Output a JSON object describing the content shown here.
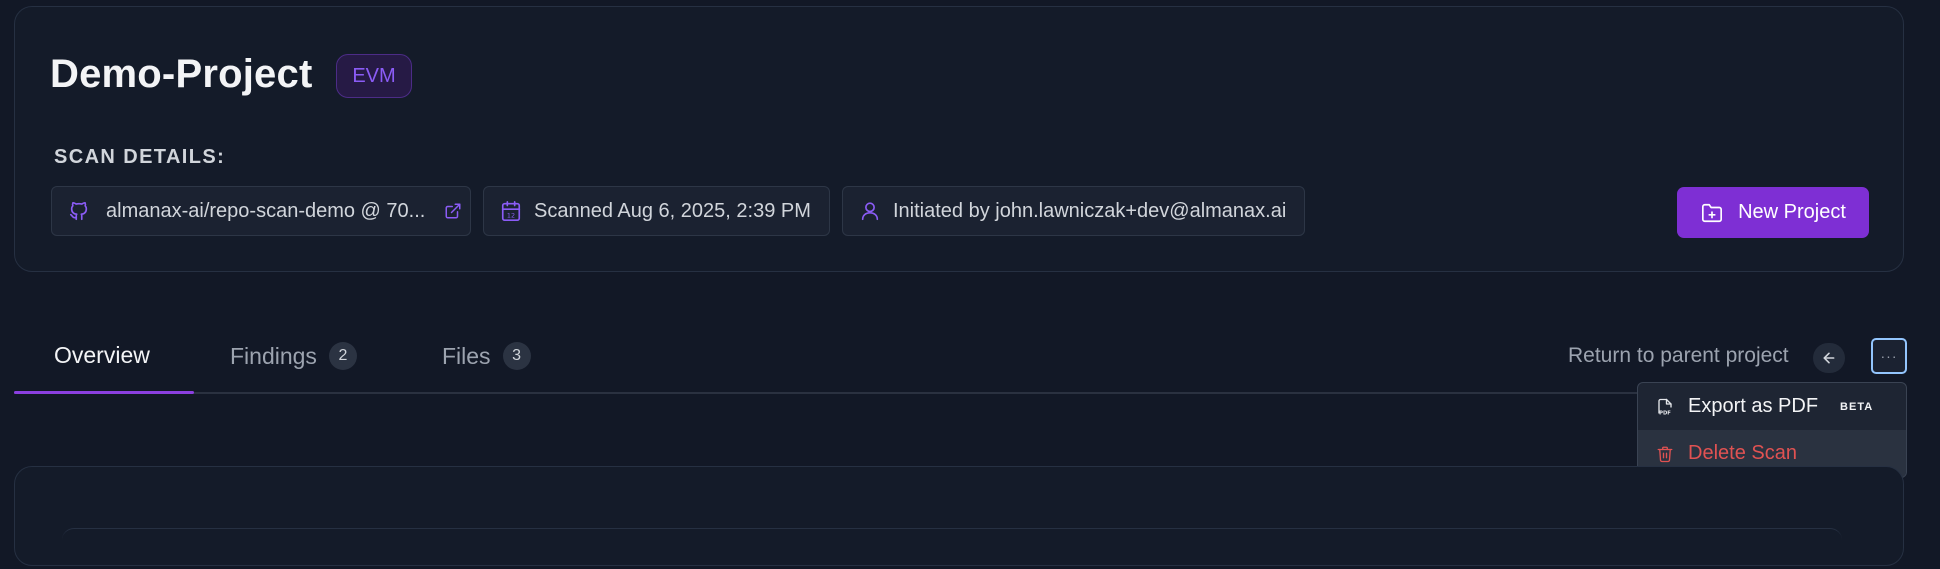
{
  "project": {
    "title": "Demo-Project",
    "chain_badge": "EVM"
  },
  "scan_details": {
    "label": "SCAN DETAILS:",
    "repo": "almanax-ai/repo-scan-demo @ 70...",
    "scanned": "Scanned Aug 6, 2025, 2:39 PM",
    "initiated_by": "Initiated by john.lawniczak+dev@almanax.ai"
  },
  "actions": {
    "new_project_label": "New Project",
    "return_label": "Return to parent project",
    "more_label": "···"
  },
  "tabs": [
    {
      "label": "Overview",
      "count": null,
      "active": true
    },
    {
      "label": "Findings",
      "count": "2",
      "active": false
    },
    {
      "label": "Files",
      "count": "3",
      "active": false
    }
  ],
  "menu": {
    "export_label": "Export as PDF",
    "beta_label": "BETA",
    "delete_label": "Delete Scan"
  },
  "colors": {
    "accent": "#7e2fd4",
    "danger": "#e05252",
    "background": "#121826"
  },
  "icons": {
    "repo": "github-icon",
    "external": "external-link-icon",
    "date": "calendar-icon",
    "user": "user-icon",
    "new_project": "folder-plus-icon",
    "back": "arrow-left-icon",
    "pdf": "pdf-file-icon",
    "delete": "trash-icon"
  }
}
